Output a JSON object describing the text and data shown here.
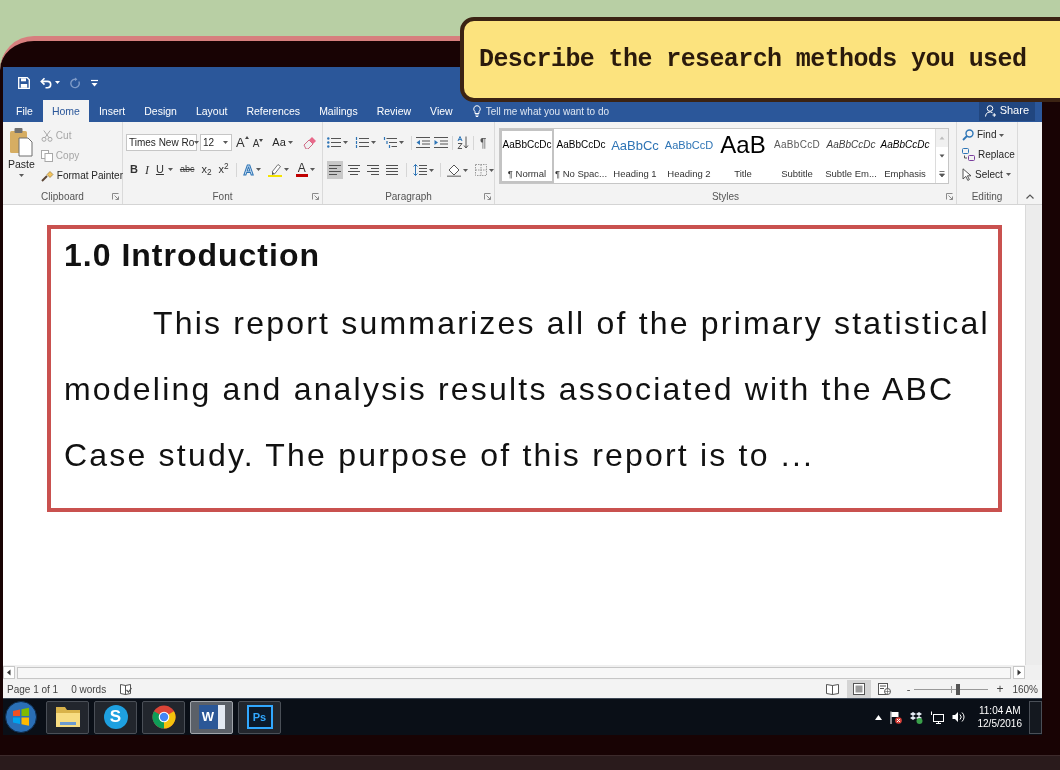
{
  "callout": {
    "text": "Describe the research methods you used"
  },
  "quick_access": [
    {
      "kind": "save",
      "disabled": false
    },
    {
      "kind": "undo",
      "disabled": false
    },
    {
      "kind": "redo",
      "disabled": true
    },
    {
      "kind": "customize",
      "disabled": false
    }
  ],
  "tabs": [
    {
      "label": "File",
      "selected": false
    },
    {
      "label": "Home",
      "selected": true
    },
    {
      "label": "Insert",
      "selected": false
    },
    {
      "label": "Design",
      "selected": false
    },
    {
      "label": "Layout",
      "selected": false
    },
    {
      "label": "References",
      "selected": false
    },
    {
      "label": "Mailings",
      "selected": false
    },
    {
      "label": "Review",
      "selected": false
    },
    {
      "label": "View",
      "selected": false
    }
  ],
  "tell_me": {
    "placeholder": "Tell me what you want to do"
  },
  "share": {
    "label": "Share"
  },
  "clipboard": {
    "label": "Clipboard",
    "paste": "Paste",
    "items": [
      {
        "kind": "cut",
        "label": "Cut",
        "disabled": true
      },
      {
        "kind": "copy",
        "label": "Copy",
        "disabled": true
      },
      {
        "kind": "format_painter",
        "label": "Format Painter",
        "disabled": false
      }
    ]
  },
  "font": {
    "label": "Font",
    "font_name": "Times New Ro",
    "font_size": "12",
    "size_buttons": [
      {
        "kind": "grow",
        "label": "A"
      },
      {
        "kind": "shrink",
        "label": "A"
      }
    ],
    "change_case": "Aa",
    "format_buttons": [
      {
        "kind": "bold",
        "label": "B"
      },
      {
        "kind": "italic",
        "label": "I"
      },
      {
        "kind": "underline",
        "label": "U"
      },
      {
        "kind": "strikethrough",
        "label": "abc"
      },
      {
        "kind": "subscript",
        "label": "x$_{2}$"
      },
      {
        "kind": "superscript",
        "label": "x$^{2}$"
      }
    ],
    "text_effects": "A",
    "font_color": "A"
  },
  "paragraph": {
    "label": "Paragraph",
    "show_marks": "¶",
    "alignments": [
      {
        "kind": "left",
        "selected": true
      },
      {
        "kind": "center",
        "selected": false
      },
      {
        "kind": "right",
        "selected": false
      },
      {
        "kind": "justify",
        "selected": false
      }
    ]
  },
  "styles": {
    "label": "Styles",
    "items": [
      {
        "kind": "normal",
        "sample": "AaBbCcDc",
        "name": "¶ Normal",
        "selected": true
      },
      {
        "kind": "no_spacing",
        "sample": "AaBbCcDc",
        "name": "¶ No Spac...",
        "selected": false
      },
      {
        "kind": "heading1",
        "sample": "AaBbCc",
        "name": "Heading 1",
        "selected": false
      },
      {
        "kind": "heading2",
        "sample": "AaBbCcD",
        "name": "Heading 2",
        "selected": false
      },
      {
        "kind": "title",
        "sample": "AaB",
        "name": "Title",
        "selected": false
      },
      {
        "kind": "subtitle",
        "sample": "AaBbCcD",
        "name": "Subtitle",
        "selected": false
      },
      {
        "kind": "subtle_emphasis",
        "sample": "AaBbCcDc",
        "name": "Subtle Em...",
        "selected": false
      },
      {
        "kind": "emphasis",
        "sample": "AaBbCcDc",
        "name": "Emphasis",
        "selected": false
      }
    ]
  },
  "editing": {
    "label": "Editing",
    "items": [
      {
        "kind": "find",
        "label": "Find"
      },
      {
        "kind": "replace",
        "label": "Replace"
      },
      {
        "kind": "select",
        "label": "Select"
      }
    ]
  },
  "document": {
    "heading": "1.0 Introduction",
    "paragraph": "This report summarizes all of the primary statistical modeling and analysis results associated with the ABC Case study. The purpose of this report is to ..."
  },
  "status_bar": {
    "page": "Page 1 of 1",
    "words": "0 words",
    "views": [
      {
        "kind": "read",
        "selected": false
      },
      {
        "kind": "print",
        "selected": true
      },
      {
        "kind": "web",
        "selected": false
      }
    ],
    "zoom_out": "-",
    "zoom": {
      "level": 0.59
    },
    "zoom_in": "+",
    "zoom_reading": "160%"
  },
  "taskbar": {
    "apps": [
      {
        "kind": "explorer",
        "selected": false
      },
      {
        "kind": "skype",
        "glyph": "S",
        "selected": false
      },
      {
        "kind": "chrome",
        "selected": false
      },
      {
        "kind": "word",
        "glyph": "W",
        "selected": true
      },
      {
        "kind": "photoshop",
        "glyph": "Ps",
        "selected": false
      }
    ],
    "time": "11:04 AM",
    "date": "12/5/2016"
  }
}
